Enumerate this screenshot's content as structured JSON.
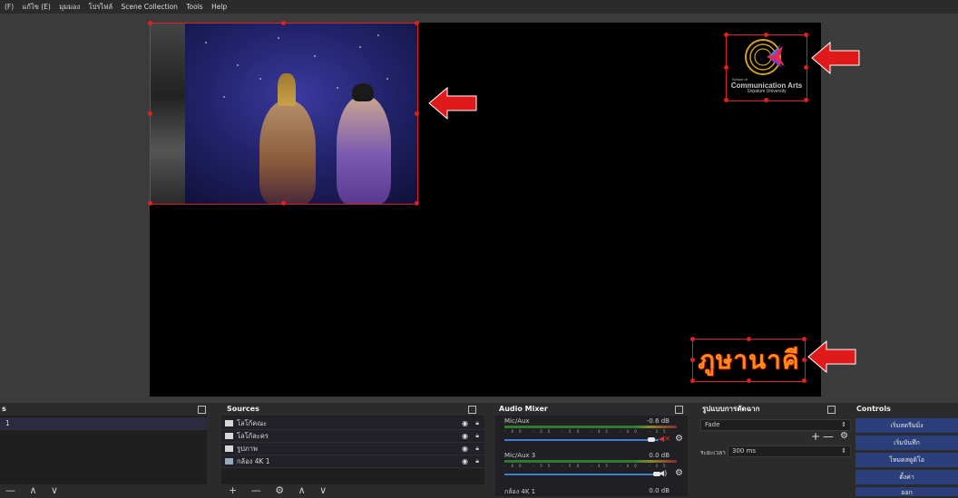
{
  "menu": {
    "items": [
      "(F)",
      "แก้ไข (E)",
      "มุมมอง",
      "โปรไฟล์",
      "Scene Collection",
      "Tools",
      "Help"
    ]
  },
  "preview": {
    "logo_line1": "School of",
    "logo_line2": "Communication Arts",
    "logo_line3": "Sripatum University",
    "title_text": "ภูษานาคี"
  },
  "scenes": {
    "title": "s",
    "items": [
      "1"
    ],
    "toolbar": "— ∧ ∨"
  },
  "sources": {
    "title": "Sources",
    "items": [
      {
        "label": "โลโก้คณะ",
        "icon": "image-icon"
      },
      {
        "label": "โลโก้ละคร",
        "icon": "image-icon"
      },
      {
        "label": "รูปภาพ",
        "icon": "image-icon"
      },
      {
        "label": "กล้อง 4K 1",
        "icon": "camera-icon"
      }
    ],
    "toolbar": "+ — ⚙ ∧ ∨"
  },
  "audio_mixer": {
    "title": "Audio Mixer",
    "channels": [
      {
        "name": "Mic/Aux",
        "db": "-0.6 dB",
        "muted": true
      },
      {
        "name": "Mic/Aux 3",
        "db": "0.0 dB",
        "muted": false
      },
      {
        "name": "กล้อง 4K 1",
        "db": "0.0 dB",
        "muted": false
      }
    ],
    "scale": "-60 -55 -50 -45 -40 -35 -30 -25 -20 -15 -10 -5 0"
  },
  "transitions": {
    "title": "รูปแบบการตัดฉาก",
    "selected": "Fade",
    "duration_label": "ระยะเวลา",
    "duration_value": "300 ms"
  },
  "controls": {
    "title": "Controls",
    "buttons": [
      "เริ่มสตรีมมิ่ง",
      "เริ่มบันทึก",
      "โหมดสตูดิโอ",
      "ตั้งค่า",
      "ออก"
    ]
  },
  "colors": {
    "accent_red": "#e02020",
    "button_blue": "#2a3f7c",
    "canvas": "#000000"
  }
}
